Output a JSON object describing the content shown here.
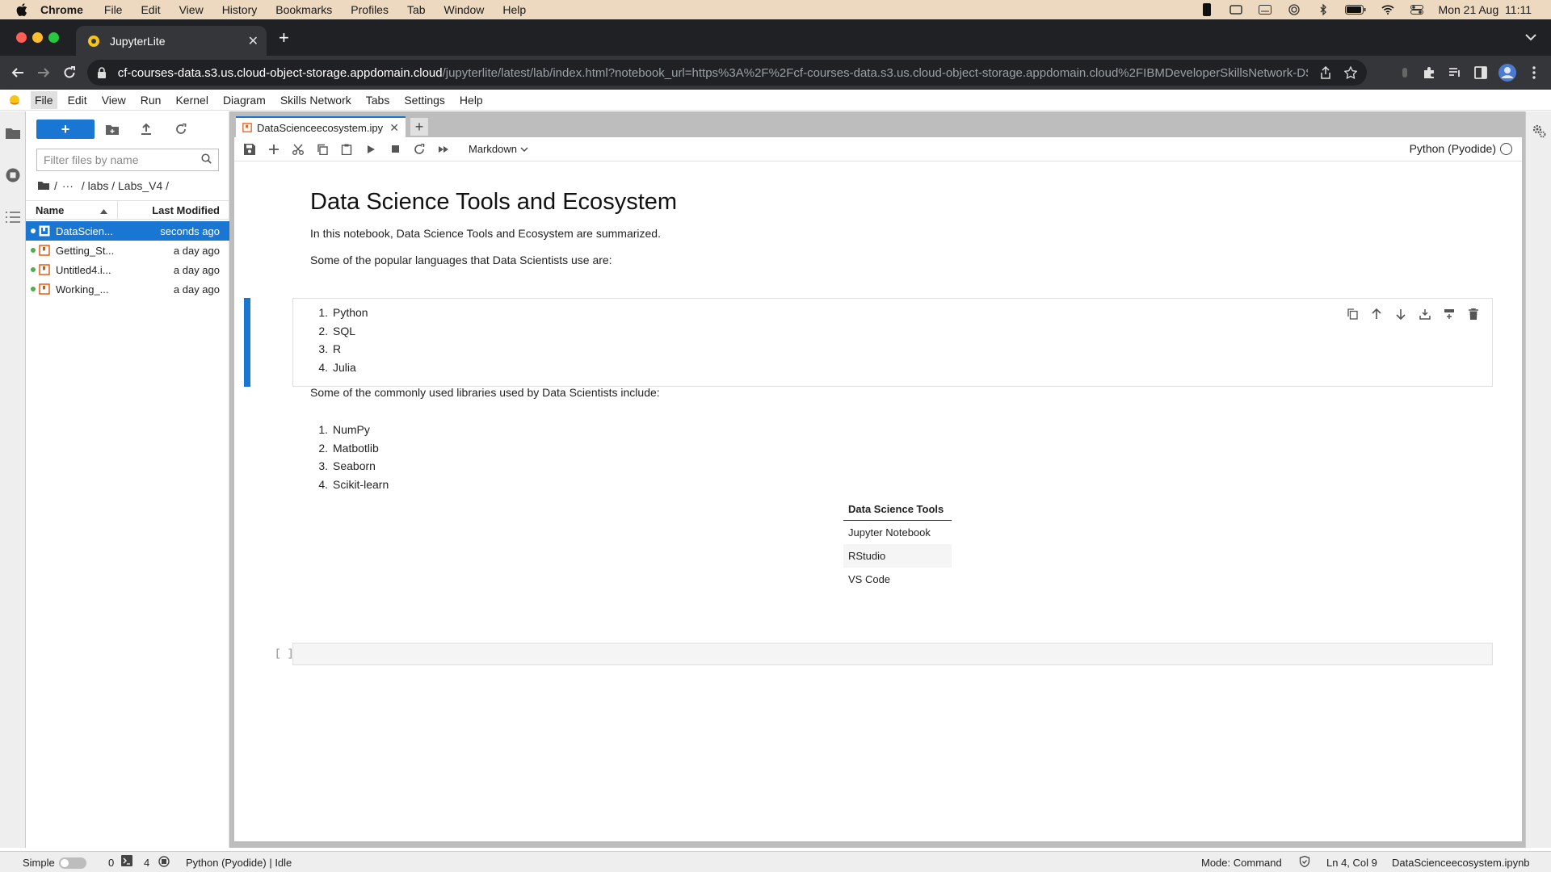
{
  "macos_menu": {
    "items": [
      "Chrome",
      "File",
      "Edit",
      "View",
      "History",
      "Bookmarks",
      "Profiles",
      "Tab",
      "Window",
      "Help"
    ],
    "clock": "Mon 21 Aug  11:11"
  },
  "browser": {
    "tab_title": "JupyterLite",
    "url_host": "cf-courses-data.s3.us.cloud-object-storage.appdomain.cloud",
    "url_path": "/jupyterlite/latest/lab/index.html?notebook_url=https%3A%2F%2Fcf-courses-data.s3.us.cloud-object-storage.appdomain.cloud%2FIBMDeveloperSkillsNetwork-DS..."
  },
  "jupyter_menu": [
    "File",
    "Edit",
    "View",
    "Run",
    "Kernel",
    "Diagram",
    "Skills Network",
    "Tabs",
    "Settings",
    "Help"
  ],
  "file_browser": {
    "new_label": "+",
    "filter_placeholder": "Filter files by name",
    "breadcrumb": [
      "/",
      "···",
      "/ labs / Labs_V4 /"
    ],
    "col_name": "Name",
    "col_modified": "Last Modified",
    "files": [
      {
        "name": "DataScien...",
        "modified": "seconds ago"
      },
      {
        "name": "Getting_St...",
        "modified": "a day ago"
      },
      {
        "name": "Untitled4.i...",
        "modified": "a day ago"
      },
      {
        "name": "Working_...",
        "modified": "a day ago"
      }
    ]
  },
  "notebook": {
    "tab_title": "DataScienceecosystem.ipy",
    "cell_type": "Markdown",
    "kernel": "Python (Pyodide)",
    "title": "Data Science Tools and Ecosystem",
    "intro": "In this notebook, Data Science Tools and Ecosystem are summarized.",
    "languages_intro": "Some of the popular languages that Data Scientists use are:",
    "languages": [
      "Python",
      "SQL",
      "R",
      "Julia"
    ],
    "libraries_intro": "Some of the commonly used libraries used by Data Scientists include:",
    "libraries": [
      "NumPy",
      "Matbotlib",
      "Seaborn",
      "Scikit-learn"
    ],
    "table": {
      "header": "Data Science Tools",
      "rows": [
        "Jupyter Notebook",
        "RStudio",
        "VS Code"
      ]
    },
    "empty_prompt": "[ ]:"
  },
  "status_bar": {
    "mode_label": "Simple",
    "terminals": "0",
    "kernels": "4",
    "kernel_status": "Python (Pyodide) | Idle",
    "mode": "Mode: Command",
    "position": "Ln 4, Col 9",
    "filename": "DataScienceecosystem.ipynb"
  },
  "colors": {
    "accent": "#1976d2",
    "mac_menubar": "#ecd9bf",
    "chrome_dark": "#202124"
  }
}
